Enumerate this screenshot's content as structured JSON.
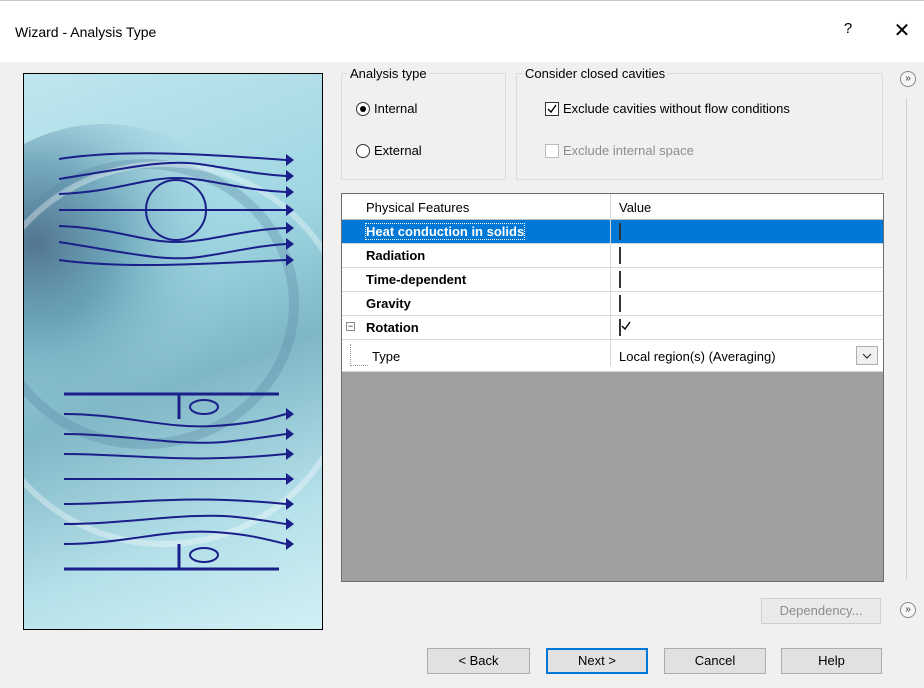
{
  "window": {
    "title": "Wizard - Analysis Type",
    "help_glyph": "?",
    "close_glyph": "✕"
  },
  "analysis_type": {
    "legend": "Analysis type",
    "options": [
      {
        "label": "Internal",
        "selected": true
      },
      {
        "label": "External",
        "selected": false
      }
    ]
  },
  "cavities": {
    "legend": "Consider closed cavities",
    "options": [
      {
        "label": "Exclude cavities without flow conditions",
        "checked": true,
        "enabled": true
      },
      {
        "label": "Exclude internal space",
        "checked": false,
        "enabled": false
      }
    ]
  },
  "features_grid": {
    "columns": [
      "Physical Features",
      "Value"
    ],
    "rows": [
      {
        "label": "Heat conduction in solids",
        "checked": false,
        "selected": true
      },
      {
        "label": "Radiation",
        "checked": false
      },
      {
        "label": "Time-dependent",
        "checked": false
      },
      {
        "label": "Gravity",
        "checked": false
      },
      {
        "label": "Rotation",
        "checked": true,
        "expanded": true
      }
    ],
    "subrow": {
      "label": "Type",
      "value": "Local region(s) (Averaging)"
    }
  },
  "buttons": {
    "dependency": "Dependency...",
    "back": "< Back",
    "next": "Next >",
    "cancel": "Cancel",
    "help": "Help"
  },
  "icons": {
    "expand": "»",
    "tree_minus": "−"
  }
}
